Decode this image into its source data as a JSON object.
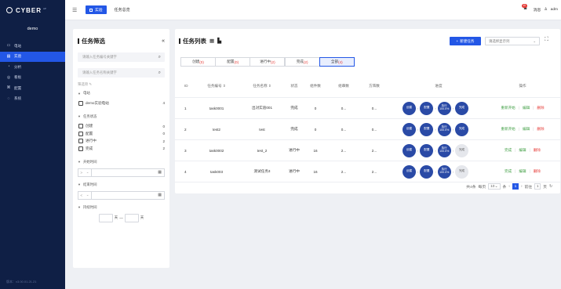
{
  "sidebar": {
    "logo_text": "CYBER",
    "logo_sup": "AP",
    "user": "demo",
    "items": [
      {
        "label": "电站",
        "icon": "grid-icon",
        "glyph": "▭"
      },
      {
        "label": "实验",
        "icon": "monitor-icon",
        "glyph": "▤"
      },
      {
        "label": "分析",
        "icon": "chart-icon",
        "glyph": "◔"
      },
      {
        "label": "看板",
        "icon": "board-icon",
        "glyph": "◎"
      },
      {
        "label": "配置",
        "icon": "settings-icon",
        "glyph": "⌘"
      },
      {
        "label": "系统",
        "icon": "shield-icon",
        "glyph": "◌"
      }
    ],
    "version": "版本：v3.00.01.21.21"
  },
  "topbar": {
    "current_tab": "实验",
    "page_tab": "任务总览",
    "notice_count": "10",
    "notice_label": "消息",
    "user_label": "adm"
  },
  "filter": {
    "title": "任务筛选",
    "search_code_placeholder": "请输入任务编号关键字",
    "search_name_placeholder": "请输入任务名称关键字",
    "condition_label": "筛选项",
    "station_section": "电站",
    "stations": [
      {
        "label": "demo实验电站",
        "count": "4"
      }
    ],
    "status_section": "任务状态",
    "statuses": [
      {
        "label": "创建",
        "count": "0"
      },
      {
        "label": "配置",
        "count": "0"
      },
      {
        "label": "进行中",
        "count": "2"
      },
      {
        "label": "完成",
        "count": "2"
      }
    ],
    "start_section": "开始时间",
    "end_section": "结束时间",
    "duration_section": "持续时间",
    "time_prefix": ">",
    "time_prefix_end": "<",
    "day_unit": "天",
    "dash": "—"
  },
  "main": {
    "title": "任务列表",
    "new_button": "新建任务",
    "column_select_placeholder": "请选择显示列",
    "tabs": [
      {
        "label": "创建",
        "count": "(0)"
      },
      {
        "label": "配置",
        "count": "(0)"
      },
      {
        "label": "进行中",
        "count": "(2)"
      },
      {
        "label": "完成",
        "count": "(2)"
      },
      {
        "label": "全部",
        "count": "(4)"
      }
    ],
    "columns": {
      "id": "ID",
      "code": "任务编号 ⇕",
      "name": "任务名称 ⇕",
      "status": "状态",
      "count": "组件数",
      "group": "组串数",
      "pieces": "方阵数",
      "flow": "进度",
      "ops": "操作"
    },
    "rows": [
      {
        "id": "1",
        "code": "task0001",
        "name": "出对实验001",
        "status": "完成",
        "count": "0",
        "group": "0...",
        "pieces": "0...",
        "flow": [
          "创建",
          "配置",
          "执行 100.0%",
          "完成"
        ],
        "last_done": true,
        "ops": [
          "重新开始",
          "编辑",
          "删除"
        ]
      },
      {
        "id": "2",
        "code": "test2",
        "name": "test",
        "status": "完成",
        "count": "0",
        "group": "0...",
        "pieces": "0...",
        "flow": [
          "创建",
          "配置",
          "执行 100.0%",
          "完成"
        ],
        "last_done": true,
        "ops": [
          "重新开始",
          "编辑",
          "删除"
        ]
      },
      {
        "id": "3",
        "code": "task0002",
        "name": "test_2",
        "status": "进行中",
        "count": "16",
        "group": "2...",
        "pieces": "2...",
        "flow": [
          "创建",
          "配置",
          "执行 100.0%",
          "完成"
        ],
        "last_done": false,
        "ops": [
          "完成",
          "编辑",
          "删除"
        ]
      },
      {
        "id": "4",
        "code": "task003",
        "name": "测试任务3",
        "status": "进行中",
        "count": "16",
        "group": "2...",
        "pieces": "2...",
        "flow": [
          "创建",
          "配置",
          "执行 100.0%",
          "完成"
        ],
        "last_done": false,
        "ops": [
          "完成",
          "编辑",
          "删除"
        ]
      }
    ],
    "pager": {
      "total": "共4条",
      "page_size_label": "每页",
      "page_size": "10",
      "unit": "条",
      "prev": "‹",
      "current": "1",
      "next": "›",
      "goto_label": "前往",
      "goto_value": "1",
      "goto_unit": "页"
    }
  }
}
